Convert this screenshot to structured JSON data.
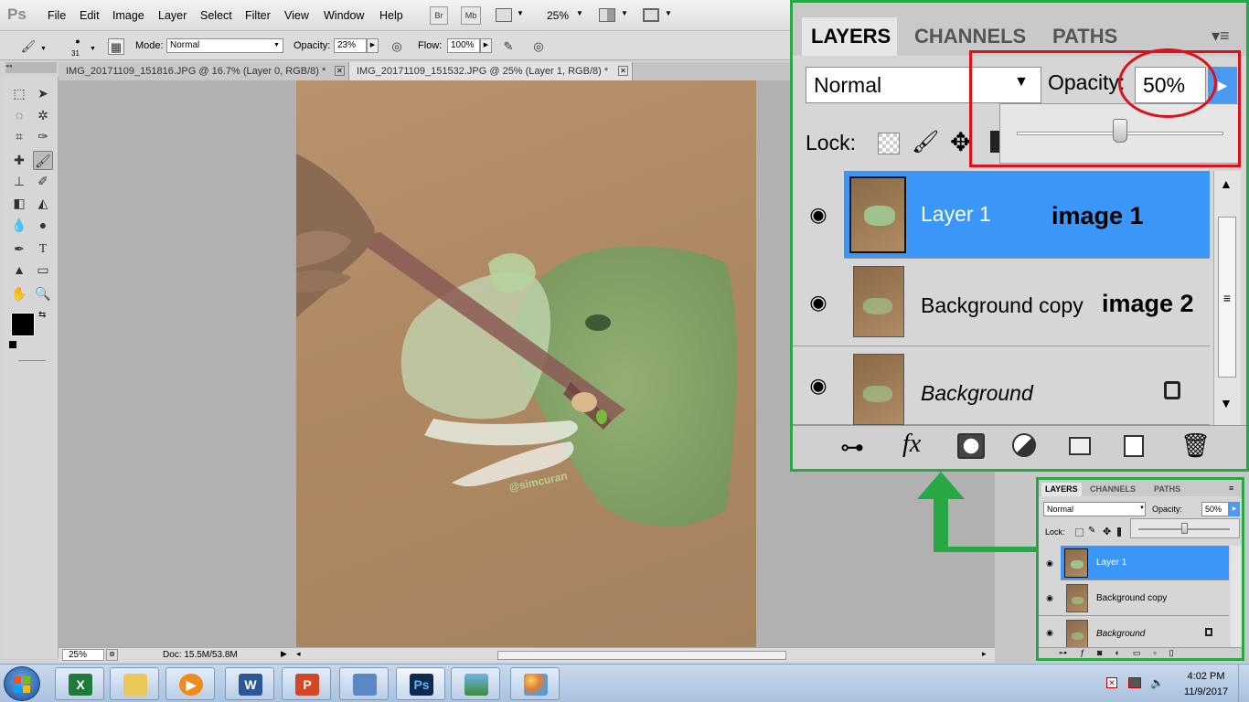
{
  "app": {
    "logo": "Ps",
    "zoom_display": "25%"
  },
  "menu": [
    "File",
    "Edit",
    "Image",
    "Layer",
    "Select",
    "Filter",
    "View",
    "Window",
    "Help"
  ],
  "menu_buttons": [
    "Br",
    "Mb"
  ],
  "options": {
    "brush_size": "31",
    "mode_label": "Mode:",
    "mode_value": "Normal",
    "opacity_label": "Opacity:",
    "opacity_value": "23%",
    "flow_label": "Flow:",
    "flow_value": "100%"
  },
  "tabs": [
    {
      "label": "IMG_20171109_151816.JPG @ 16.7% (Layer 0, RGB/8) *"
    },
    {
      "label": "IMG_20171109_151532.JPG @ 25% (Layer 1, RGB/8) *"
    }
  ],
  "status": {
    "zoom": "25%",
    "doc": "Doc: 15.5M/53.8M"
  },
  "layers_panel": {
    "tabs": [
      "LAYERS",
      "CHANNELS",
      "PATHS"
    ],
    "blend_mode": "Normal",
    "opacity_label": "Opacity:",
    "opacity_value": "50%",
    "opacity_slider": 0.5,
    "lock_label": "Lock:",
    "layers": [
      {
        "name": "Layer 1",
        "selected": true
      },
      {
        "name": "Background copy",
        "selected": false
      },
      {
        "name": "Background",
        "selected": false,
        "locked": true
      }
    ]
  },
  "annotations": {
    "image1": "image 1",
    "image2": "image 2"
  },
  "artwork": {
    "watermark": "@simcuran"
  },
  "colors": {
    "highlight": "#27a844",
    "circle": "#e0101a",
    "selection": "#3b97f7"
  },
  "clock": {
    "time": "4:02 PM",
    "date": "11/9/2017"
  },
  "taskbar_apps": [
    {
      "icon": "excel-icon",
      "glyph": "X"
    },
    {
      "icon": "explorer-icon",
      "glyph": ""
    },
    {
      "icon": "media-player-icon",
      "glyph": "▶"
    },
    {
      "icon": "word-icon",
      "glyph": "W"
    },
    {
      "icon": "powerpoint-icon",
      "glyph": "P"
    },
    {
      "icon": "remote-desktop-icon",
      "glyph": ""
    },
    {
      "icon": "photoshop-icon",
      "glyph": "Ps"
    },
    {
      "icon": "photo-viewer-icon",
      "glyph": ""
    },
    {
      "icon": "paint-icon",
      "glyph": ""
    }
  ]
}
